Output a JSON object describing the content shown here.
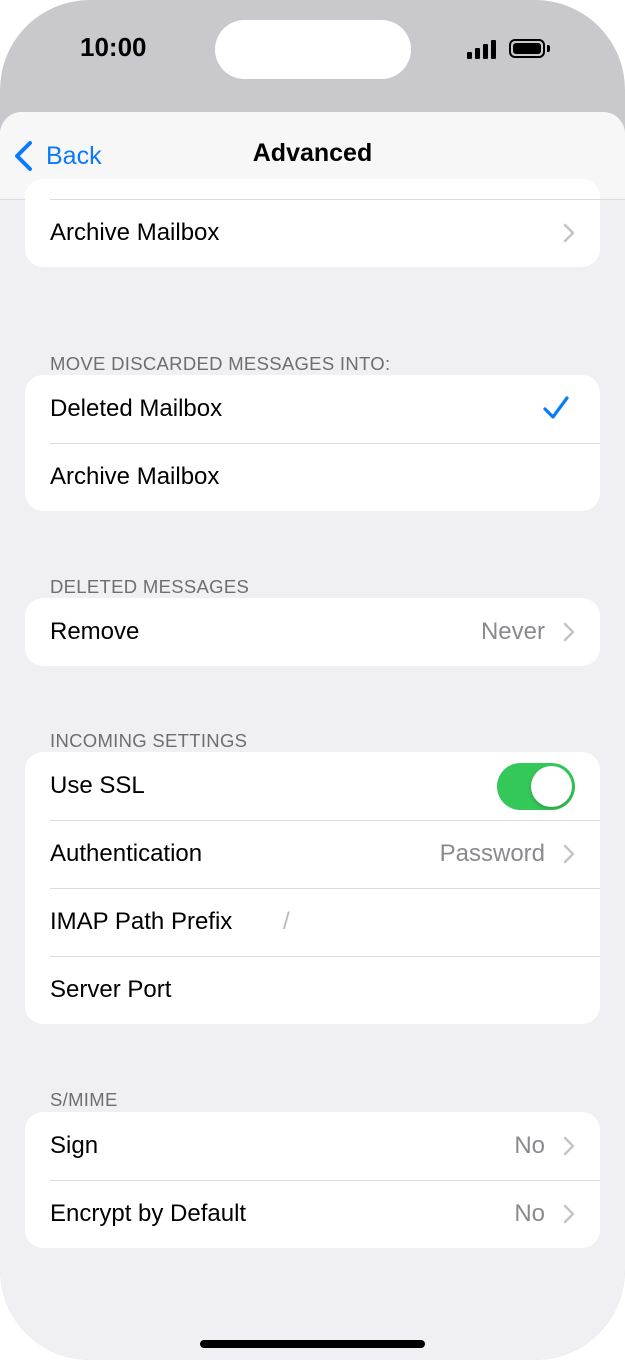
{
  "status_bar": {
    "time": "10:00"
  },
  "nav": {
    "back_label": "Back",
    "title": "Advanced"
  },
  "top_group": {
    "archive_label": "Archive Mailbox"
  },
  "move_discarded": {
    "header": "MOVE DISCARDED MESSAGES INTO:",
    "options": [
      {
        "label": "Deleted Mailbox",
        "selected": true
      },
      {
        "label": "Archive Mailbox",
        "selected": false
      }
    ]
  },
  "deleted_messages": {
    "header": "DELETED MESSAGES",
    "remove_label": "Remove",
    "remove_value": "Never"
  },
  "incoming": {
    "header": "INCOMING SETTINGS",
    "use_ssl_label": "Use SSL",
    "use_ssl_on": true,
    "authentication_label": "Authentication",
    "authentication_value": "Password",
    "imap_prefix_label": "IMAP Path Prefix",
    "imap_prefix_value": "/",
    "server_port_label": "Server Port"
  },
  "smime": {
    "header": "S/MIME",
    "sign_label": "Sign",
    "sign_value": "No",
    "encrypt_label": "Encrypt by Default",
    "encrypt_value": "No"
  },
  "colors": {
    "accent": "#0a7aff",
    "toggle_on": "#34c759",
    "background": "#efeff4"
  },
  "icons": [
    "back-chevron-icon",
    "chevron-right-icon",
    "checkmark-icon",
    "cellular-signal-icon",
    "battery-icon"
  ]
}
